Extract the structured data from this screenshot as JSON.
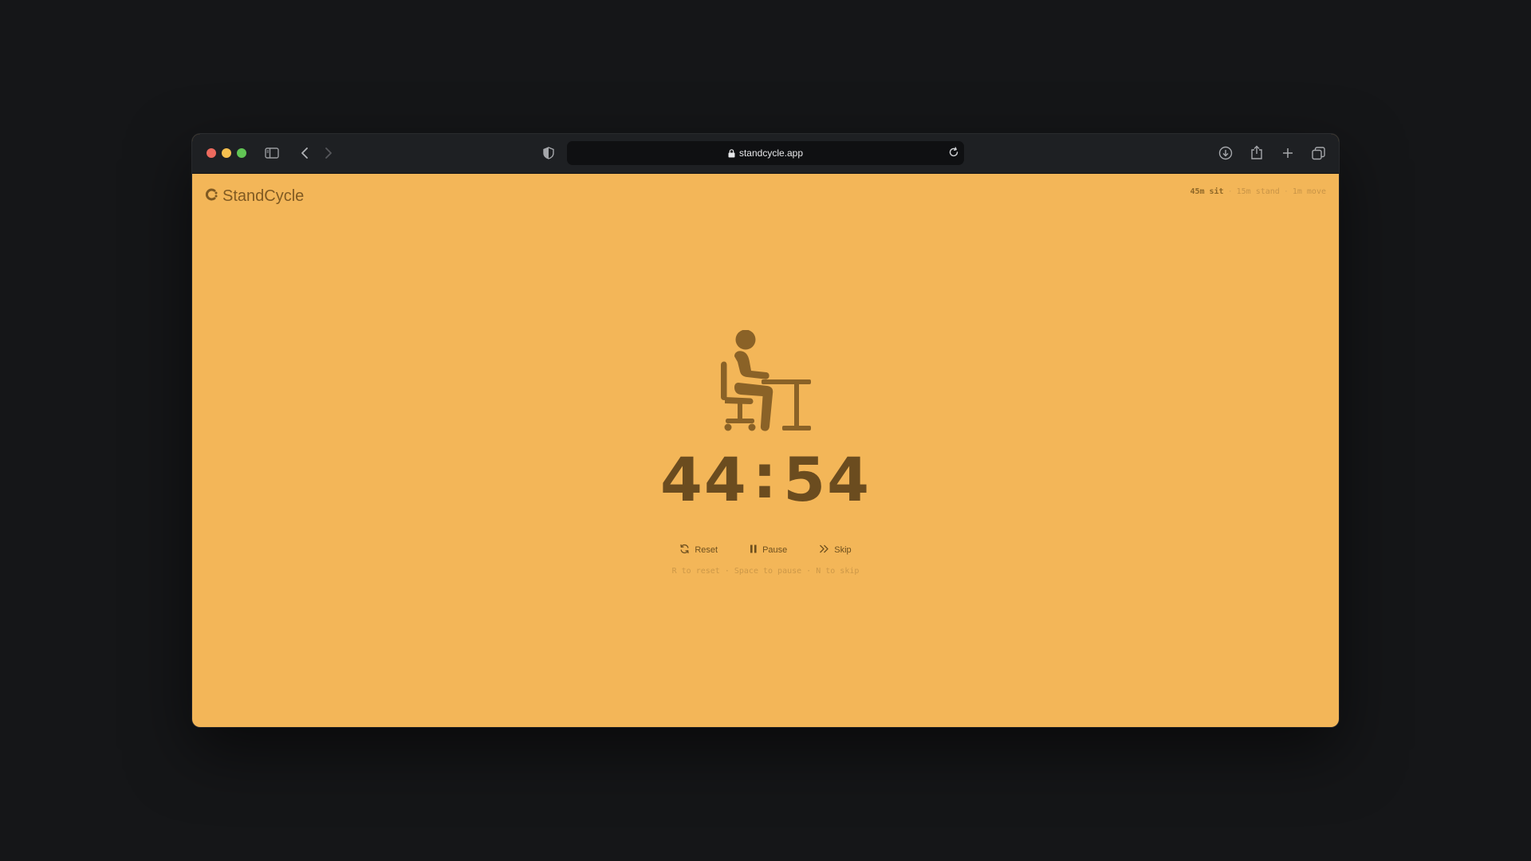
{
  "browser": {
    "url": "standcycle.app"
  },
  "app": {
    "brand": "StandCycle",
    "schedule": {
      "current": "45m sit",
      "next": "15m stand",
      "last": "1m move",
      "separator": "·"
    },
    "mode_icon": "person-sitting-at-desk-icon",
    "timer": {
      "minutes": "44",
      "seconds": "54",
      "colon": ":"
    },
    "controls": {
      "reset_label": "Reset",
      "pause_label": "Pause",
      "skip_label": "Skip"
    },
    "hint": "R to reset · Space to pause · N to skip"
  },
  "colors": {
    "page_background": "#f3b658",
    "accent_text": "#6b4c1f",
    "desktop": "#151618"
  }
}
